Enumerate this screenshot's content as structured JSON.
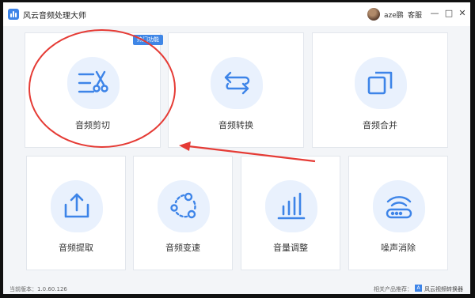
{
  "app": {
    "title": "风云音频处理大师"
  },
  "header": {
    "username": "aze鹏",
    "service_label": "客服"
  },
  "window_controls": {
    "minimize": "—",
    "maximize": "□",
    "close": "✕"
  },
  "hot_badge": "热门功能",
  "tools": [
    {
      "label": "音频剪切",
      "icon": "scissors-icon"
    },
    {
      "label": "音频转换",
      "icon": "convert-arrows-icon"
    },
    {
      "label": "音频合并",
      "icon": "merge-squares-icon"
    },
    {
      "label": "音频提取",
      "icon": "extract-upload-icon"
    },
    {
      "label": "音频变速",
      "icon": "speed-nodes-icon"
    },
    {
      "label": "音量调整",
      "icon": "volume-bars-icon"
    },
    {
      "label": "噪声消除",
      "icon": "noise-wifi-icon"
    }
  ],
  "footer": {
    "version": "当前版本：1.0.60.126",
    "recommend": "相关产品推荐：",
    "product": "风云视频转换器",
    "product_icon": "A"
  },
  "colors": {
    "accent": "#3d84e8",
    "annotation": "#e53b35"
  }
}
